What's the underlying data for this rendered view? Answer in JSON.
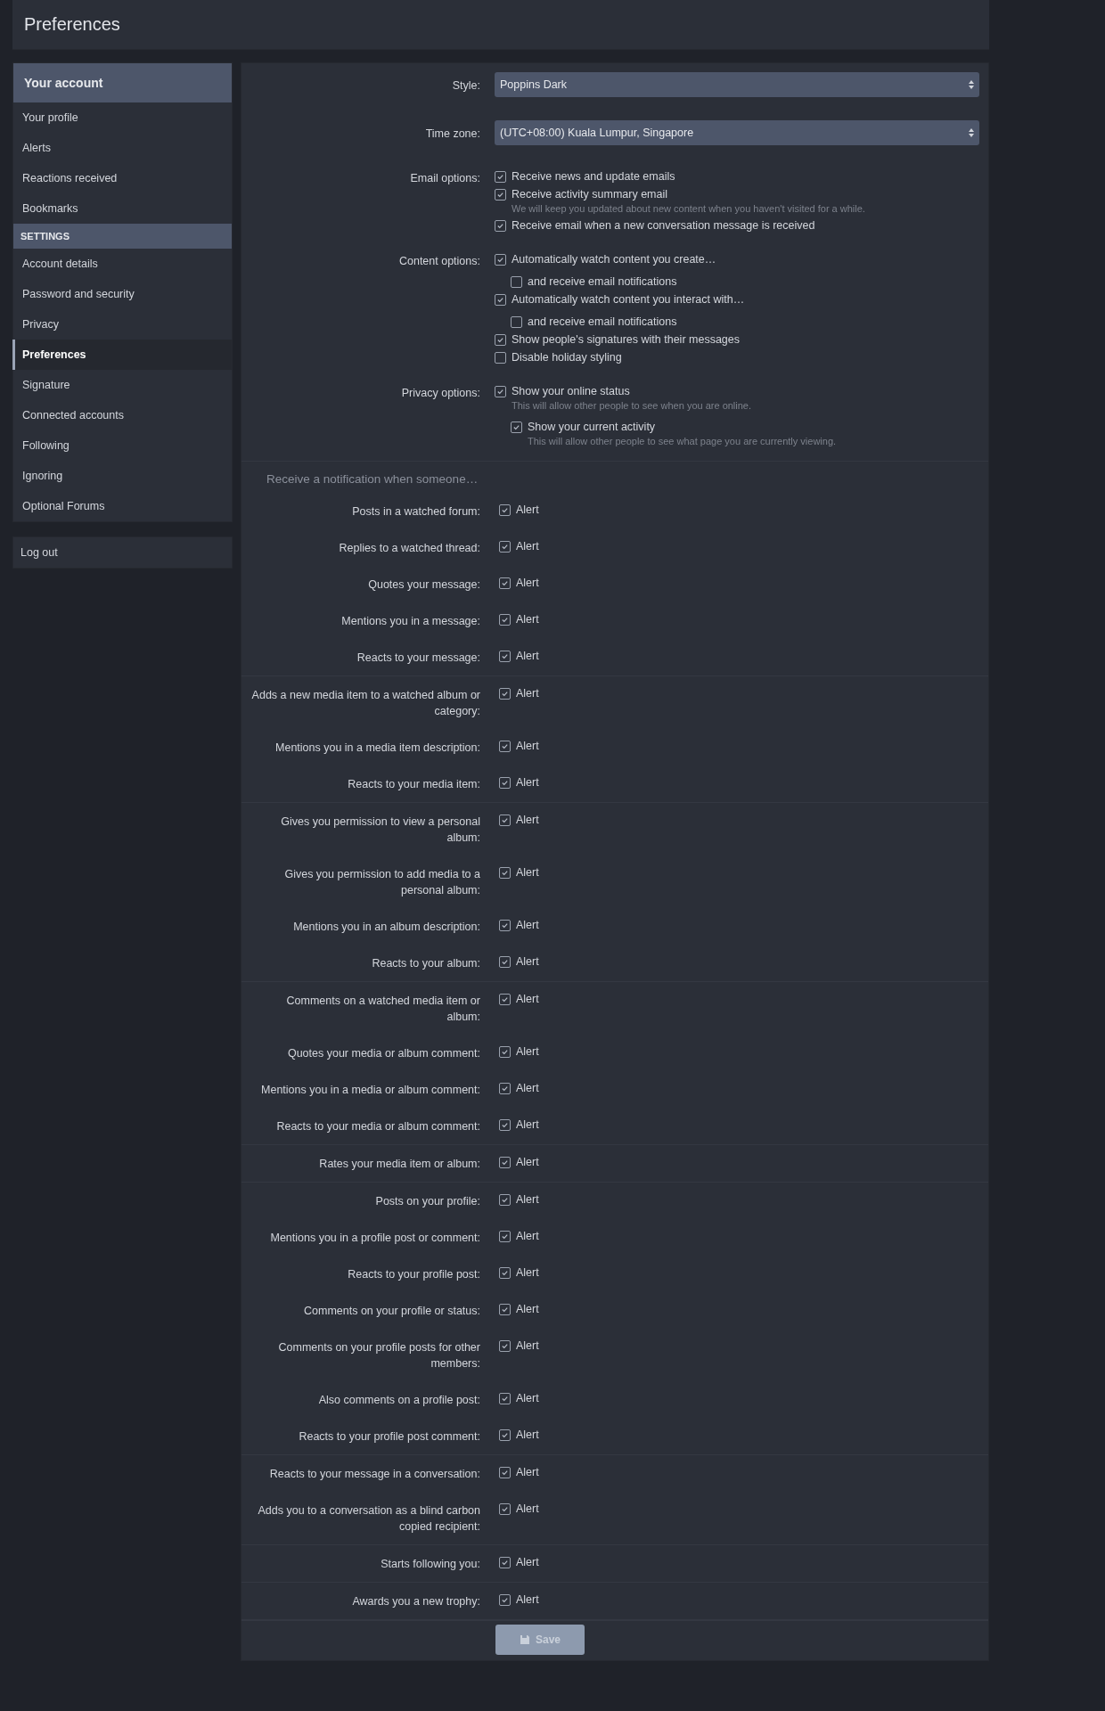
{
  "page_title": "Preferences",
  "sidebar": {
    "groups": [
      {
        "title": "Your account",
        "kind": "main",
        "items": [
          {
            "label": "Your profile",
            "selected": false
          },
          {
            "label": "Alerts",
            "selected": false
          },
          {
            "label": "Reactions received",
            "selected": false
          },
          {
            "label": "Bookmarks",
            "selected": false
          }
        ]
      },
      {
        "title": "SETTINGS",
        "kind": "sub",
        "items": [
          {
            "label": "Account details",
            "selected": false
          },
          {
            "label": "Password and security",
            "selected": false
          },
          {
            "label": "Privacy",
            "selected": false
          },
          {
            "label": "Preferences",
            "selected": true
          },
          {
            "label": "Signature",
            "selected": false
          },
          {
            "label": "Connected accounts",
            "selected": false
          },
          {
            "label": "Following",
            "selected": false
          },
          {
            "label": "Ignoring",
            "selected": false
          },
          {
            "label": "Optional Forums",
            "selected": false
          }
        ]
      }
    ],
    "logout": "Log out"
  },
  "options": [
    {
      "label": "Style:",
      "kind": "select",
      "value": "Poppins Dark"
    },
    {
      "label": "Time zone:",
      "kind": "select",
      "value": "(UTC+08:00) Kuala Lumpur, Singapore"
    },
    {
      "label": "Email options:",
      "kind": "checks",
      "checks": [
        {
          "text": "Receive news and update emails",
          "checked": true
        },
        {
          "text": "Receive activity summary email",
          "checked": true,
          "hint": "We will keep you updated about new content when you haven't visited for a while."
        },
        {
          "text": "Receive email when a new conversation message is received",
          "checked": true
        }
      ]
    },
    {
      "label": "Content options:",
      "kind": "checks",
      "checks": [
        {
          "text": "Automatically watch content you create…",
          "checked": true,
          "children": [
            {
              "text": "and receive email notifications",
              "checked": false
            }
          ]
        },
        {
          "text": "Automatically watch content you interact with…",
          "checked": true,
          "children": [
            {
              "text": "and receive email notifications",
              "checked": false
            }
          ]
        },
        {
          "text": "Show people's signatures with their messages",
          "checked": true
        },
        {
          "text": "Disable holiday styling",
          "checked": false
        }
      ]
    },
    {
      "label": "Privacy options:",
      "kind": "checks",
      "checks": [
        {
          "text": "Show your online status",
          "checked": true,
          "hint": "This will allow other people to see when you are online.",
          "children": [
            {
              "text": "Show your current activity",
              "checked": true,
              "hint": "This will allow other people to see what page you are currently viewing."
            }
          ]
        }
      ]
    }
  ],
  "notifications": {
    "title": "Receive a notification when someone…",
    "groups": [
      {
        "rows": [
          {
            "label": "Posts in a watched forum:",
            "option": "Alert",
            "checked": true
          },
          {
            "label": "Replies to a watched thread:",
            "option": "Alert",
            "checked": true
          },
          {
            "label": "Quotes your message:",
            "option": "Alert",
            "checked": true
          },
          {
            "label": "Mentions you in a message:",
            "option": "Alert",
            "checked": true
          },
          {
            "label": "Reacts to your message:",
            "option": "Alert",
            "checked": true
          }
        ]
      },
      {
        "rows": [
          {
            "label": "Adds a new media item to a watched album or category:",
            "option": "Alert",
            "checked": true
          },
          {
            "label": "Mentions you in a media item description:",
            "option": "Alert",
            "checked": true
          },
          {
            "label": "Reacts to your media item:",
            "option": "Alert",
            "checked": true
          }
        ]
      },
      {
        "rows": [
          {
            "label": "Gives you permission to view a personal album:",
            "option": "Alert",
            "checked": true
          },
          {
            "label": "Gives you permission to add media to a personal album:",
            "option": "Alert",
            "checked": true
          },
          {
            "label": "Mentions you in an album description:",
            "option": "Alert",
            "checked": true
          },
          {
            "label": "Reacts to your album:",
            "option": "Alert",
            "checked": true
          }
        ]
      },
      {
        "rows": [
          {
            "label": "Comments on a watched media item or album:",
            "option": "Alert",
            "checked": true
          },
          {
            "label": "Quotes your media or album comment:",
            "option": "Alert",
            "checked": true
          },
          {
            "label": "Mentions you in a media or album comment:",
            "option": "Alert",
            "checked": true
          },
          {
            "label": "Reacts to your media or album comment:",
            "option": "Alert",
            "checked": true
          }
        ]
      },
      {
        "rows": [
          {
            "label": "Rates your media item or album:",
            "option": "Alert",
            "checked": true
          }
        ]
      },
      {
        "rows": [
          {
            "label": "Posts on your profile:",
            "option": "Alert",
            "checked": true
          },
          {
            "label": "Mentions you in a profile post or comment:",
            "option": "Alert",
            "checked": true
          },
          {
            "label": "Reacts to your profile post:",
            "option": "Alert",
            "checked": true
          },
          {
            "label": "Comments on your profile or status:",
            "option": "Alert",
            "checked": true
          },
          {
            "label": "Comments on your profile posts for other members:",
            "option": "Alert",
            "checked": true
          },
          {
            "label": "Also comments on a profile post:",
            "option": "Alert",
            "checked": true
          },
          {
            "label": "Reacts to your profile post comment:",
            "option": "Alert",
            "checked": true
          }
        ]
      },
      {
        "rows": [
          {
            "label": "Reacts to your message in a conversation:",
            "option": "Alert",
            "checked": true
          },
          {
            "label": "Adds you to a conversation as a blind carbon copied recipient:",
            "option": "Alert",
            "checked": true
          }
        ]
      },
      {
        "rows": [
          {
            "label": "Starts following you:",
            "option": "Alert",
            "checked": true
          }
        ]
      },
      {
        "rows": [
          {
            "label": "Awards you a new trophy:",
            "option": "Alert",
            "checked": true
          }
        ]
      }
    ]
  },
  "save": "Save"
}
